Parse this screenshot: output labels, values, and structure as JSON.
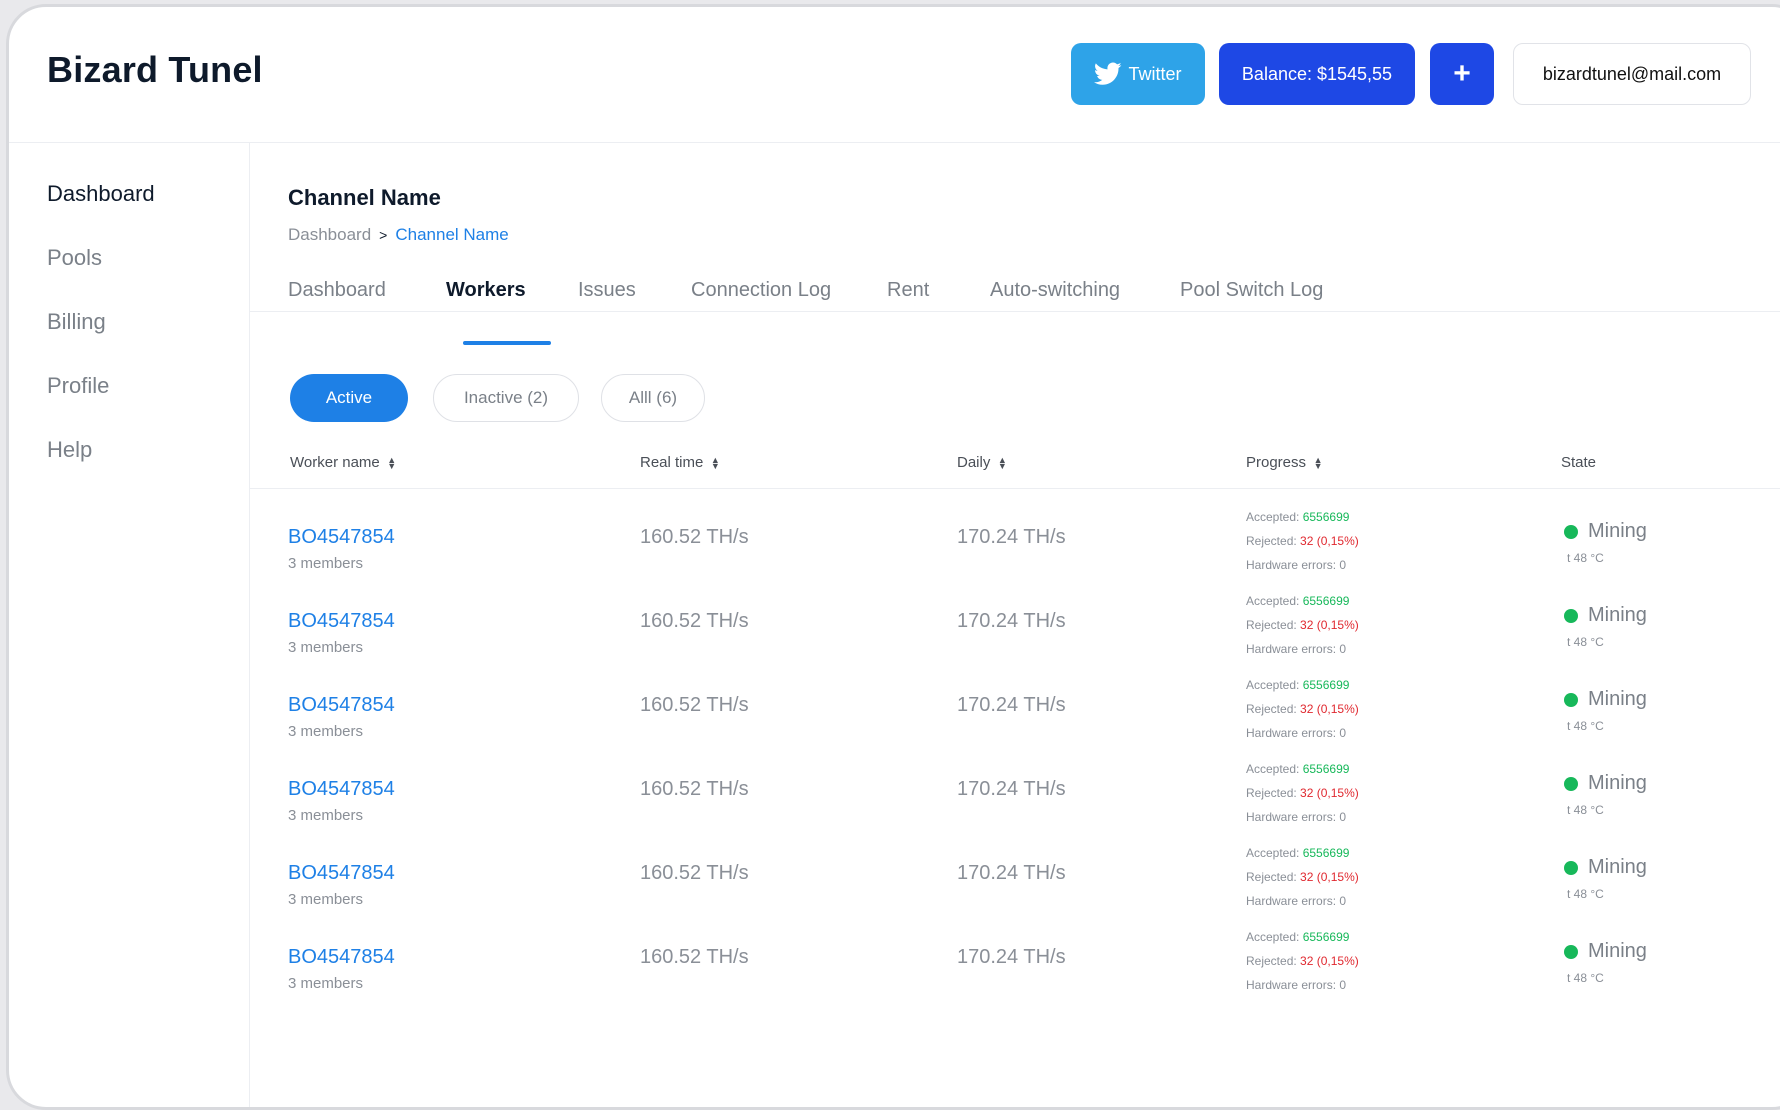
{
  "app": {
    "logo": "Bizard Tunel"
  },
  "topbar": {
    "twitter_label": "Twitter",
    "balance_label": "Balance: $1545,55",
    "plus_label": "+",
    "email": "bizardtunel@mail.com"
  },
  "sidebar": {
    "items": [
      {
        "label": "Dashboard",
        "active": true
      },
      {
        "label": "Pools"
      },
      {
        "label": "Billing"
      },
      {
        "label": "Profile"
      },
      {
        "label": "Help"
      }
    ]
  },
  "page": {
    "title": "Channel Name",
    "breadcrumb": {
      "root": "Dashboard",
      "separator": ">",
      "current": "Channel Name"
    }
  },
  "tabs": [
    {
      "label": "Dashboard"
    },
    {
      "label": "Workers",
      "active": true
    },
    {
      "label": "Issues"
    },
    {
      "label": "Connection Log"
    },
    {
      "label": "Rent"
    },
    {
      "label": "Auto-switching"
    },
    {
      "label": "Pool Switch Log"
    }
  ],
  "filters": {
    "active": "Active",
    "inactive": "Inactive (2)",
    "all": "Alll (6)"
  },
  "table": {
    "headers": {
      "worker": "Worker name",
      "realtime": "Real time",
      "daily": "Daily",
      "progress": "Progress",
      "state": "State"
    },
    "rows": [
      {
        "name": "BO4547854",
        "members": "3 members",
        "realtime": "160.52 TH/s",
        "daily": "170.24 TH/s",
        "accepted_label": "Accepted: ",
        "accepted": "6556699",
        "rejected_label": "Rejected: ",
        "rejected": "32 (0,15%)",
        "hw": "Hardware errors: 0",
        "state": "Mining",
        "temp": "t 48 °C"
      },
      {
        "name": "BO4547854",
        "members": "3 members",
        "realtime": "160.52 TH/s",
        "daily": "170.24 TH/s",
        "accepted_label": "Accepted: ",
        "accepted": "6556699",
        "rejected_label": "Rejected: ",
        "rejected": "32 (0,15%)",
        "hw": "Hardware errors: 0",
        "state": "Mining",
        "temp": "t 48 °C"
      },
      {
        "name": "BO4547854",
        "members": "3 members",
        "realtime": "160.52 TH/s",
        "daily": "170.24 TH/s",
        "accepted_label": "Accepted: ",
        "accepted": "6556699",
        "rejected_label": "Rejected: ",
        "rejected": "32 (0,15%)",
        "hw": "Hardware errors: 0",
        "state": "Mining",
        "temp": "t 48 °C"
      },
      {
        "name": "BO4547854",
        "members": "3 members",
        "realtime": "160.52 TH/s",
        "daily": "170.24 TH/s",
        "accepted_label": "Accepted: ",
        "accepted": "6556699",
        "rejected_label": "Rejected: ",
        "rejected": "32 (0,15%)",
        "hw": "Hardware errors: 0",
        "state": "Mining",
        "temp": "t 48 °C"
      },
      {
        "name": "BO4547854",
        "members": "3 members",
        "realtime": "160.52 TH/s",
        "daily": "170.24 TH/s",
        "accepted_label": "Accepted: ",
        "accepted": "6556699",
        "rejected_label": "Rejected: ",
        "rejected": "32 (0,15%)",
        "hw": "Hardware errors: 0",
        "state": "Mining",
        "temp": "t 48 °C"
      },
      {
        "name": "BO4547854",
        "members": "3 members",
        "realtime": "160.52 TH/s",
        "daily": "170.24 TH/s",
        "accepted_label": "Accepted: ",
        "accepted": "6556699",
        "rejected_label": "Rejected: ",
        "rejected": "32 (0,15%)",
        "hw": "Hardware errors: 0",
        "state": "Mining",
        "temp": "t 48 °C"
      }
    ]
  },
  "colors": {
    "primary": "#1e80e6",
    "brand_dark": "#1e48e5",
    "twitter": "#2ea3e8",
    "success": "#17b85a",
    "danger": "#e0282f"
  },
  "icons": {
    "twitter": "twitter-bird-icon",
    "sort": "sort-icon",
    "status": "status-dot-icon"
  }
}
